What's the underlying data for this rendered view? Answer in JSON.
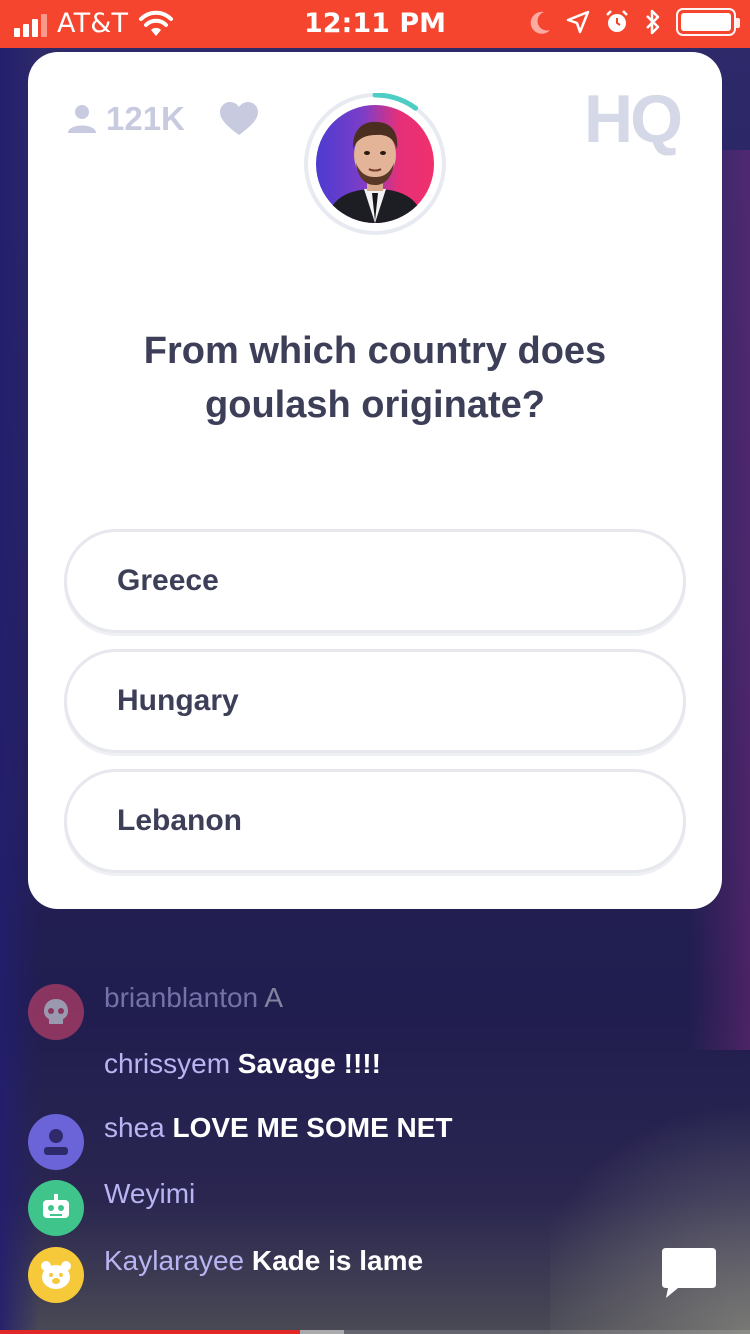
{
  "status_bar": {
    "carrier": "AT&T",
    "time": "12:11 PM",
    "bg_color": "#f5452f"
  },
  "card": {
    "viewers": "121K",
    "logo": "HQ",
    "question": "From which country does goulash originate?",
    "answers": [
      {
        "label": "Greece"
      },
      {
        "label": "Hungary"
      },
      {
        "label": "Lebanon"
      }
    ],
    "timer_progress": 0.1,
    "icons": [
      "person-icon",
      "heart-icon"
    ]
  },
  "chat": {
    "messages": [
      {
        "user": "brianblanton",
        "text": "A",
        "avatar": "skull",
        "avatar_color": "#e2496f"
      },
      {
        "user": "chrissyem",
        "text": "Savage !!!!",
        "avatar": "none"
      },
      {
        "user": "shea",
        "text": "LOVE ME SOME NET",
        "avatar": "person",
        "avatar_color": "#6a64d8"
      },
      {
        "user": "Weyimi",
        "text": "",
        "avatar": "robot",
        "avatar_color": "#3fc58b"
      },
      {
        "user": "Kaylarayee",
        "text": "Kade is lame",
        "avatar": "bear",
        "avatar_color": "#f5c93a"
      }
    ]
  },
  "video_progress": {
    "played": 0.4
  },
  "colors": {
    "accent": "#4ecdc4",
    "chat_user": "#b9b4f2",
    "background": "#28245e"
  }
}
